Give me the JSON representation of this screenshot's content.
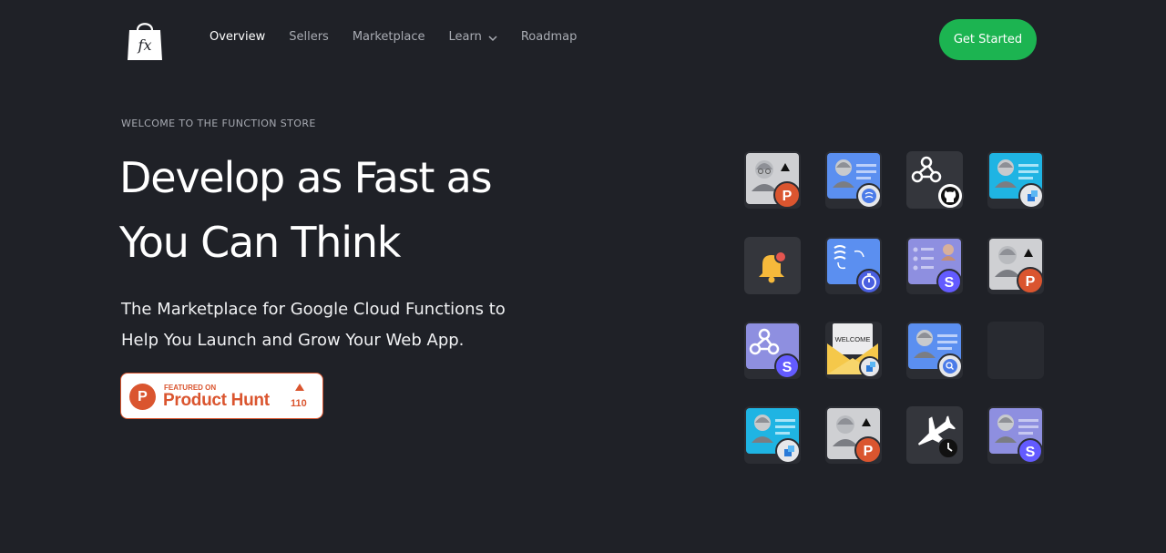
{
  "nav": {
    "logo_alt": "fx shopping bag logo",
    "links": [
      {
        "label": "Overview",
        "active": true
      },
      {
        "label": "Sellers",
        "active": false
      },
      {
        "label": "Marketplace",
        "active": false
      },
      {
        "label": "Learn",
        "active": false,
        "has_dropdown": true
      },
      {
        "label": "Roadmap",
        "active": false
      }
    ],
    "cta_label": "Get Started"
  },
  "hero": {
    "eyebrow": "WELCOME TO THE FUNCTION STORE",
    "headline_line1": "Develop as Fast as",
    "headline_line2": "You Can Think",
    "sub_line1": "The Marketplace for Google Cloud Functions to",
    "sub_line2": "Help You Launch and Grow Your Web App."
  },
  "product_hunt": {
    "featured_label": "FEATURED ON",
    "name": "Product Hunt",
    "upvotes": "110"
  },
  "function_icons": [
    {
      "name": "contact-card-gray-producthunt-icon"
    },
    {
      "name": "contact-card-blue-stream-icon"
    },
    {
      "name": "webhook-github-icon"
    },
    {
      "name": "contact-card-cyan-stack-icon"
    },
    {
      "name": "notification-bell-icon"
    },
    {
      "name": "stream-timer-icon"
    },
    {
      "name": "list-card-stripe-icon"
    },
    {
      "name": "contact-card-gray-producthunt-icon"
    },
    {
      "name": "webhook-stripe-icon"
    },
    {
      "name": "welcome-envelope-icon",
      "label": "WELCOME"
    },
    {
      "name": "contact-card-blue-search-icon"
    },
    {
      "name": "empty-slot"
    },
    {
      "name": "contact-card-cyan-stack-icon"
    },
    {
      "name": "contact-card-gray-producthunt-icon"
    },
    {
      "name": "flight-schedule-icon"
    },
    {
      "name": "contact-card-purple-stripe-icon"
    }
  ],
  "colors": {
    "background": "#1f2127",
    "cta_green": "#1cb451",
    "product_hunt_orange": "#da552f",
    "stripe_purple": "#635bff"
  }
}
